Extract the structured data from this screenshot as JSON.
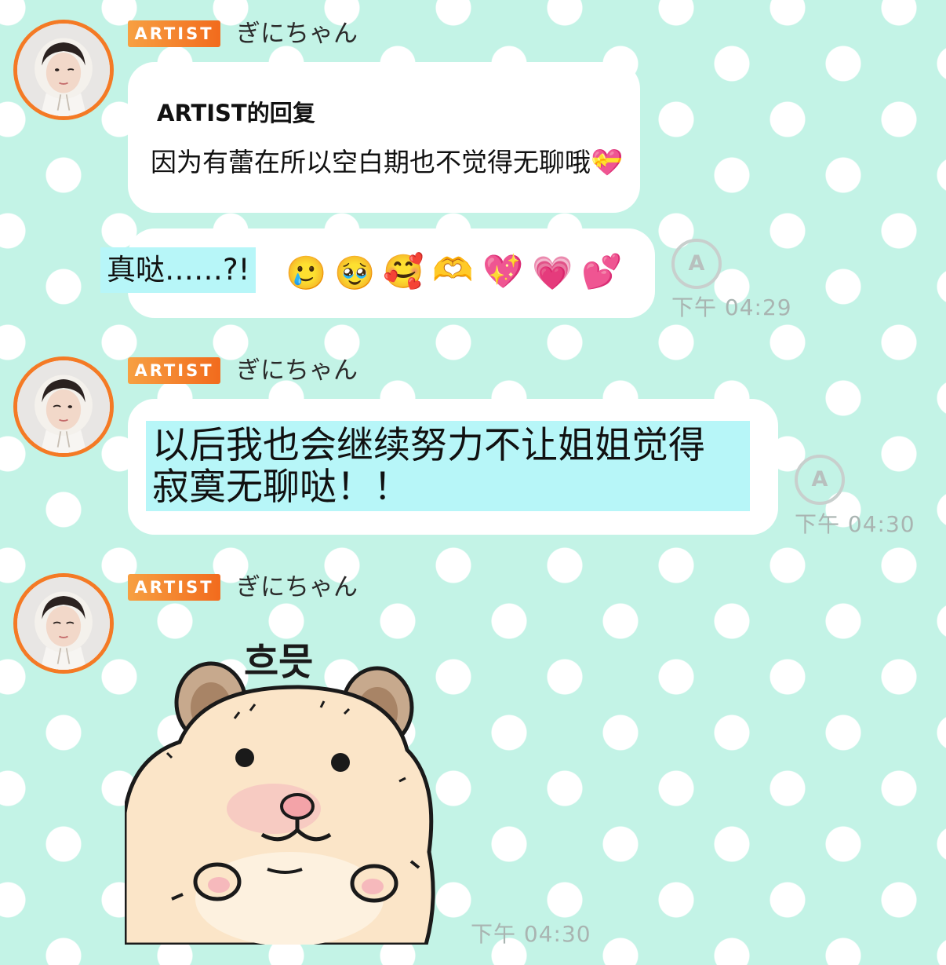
{
  "messages": [
    {
      "badge": "ARTIST",
      "sender": "ぎにちゃん",
      "reply_label": "ARTIST的回复",
      "reply_text": "因为有蕾在所以空白期也不觉得无聊哦💝"
    },
    {
      "text": "真哒……?!",
      "emojis": [
        "🥲",
        "🥹",
        "🥰",
        "🫶",
        "💖",
        "💗",
        "💕"
      ],
      "time": "下午 04:29"
    },
    {
      "badge": "ARTIST",
      "sender": "ぎにちゃん",
      "line1": "以后我也会继续努力不让姐姐觉得",
      "line2": "寂寞无聊哒！！",
      "time": "下午 04:30"
    },
    {
      "badge": "ARTIST",
      "sender": "ぎにちゃん",
      "sticker_text": "흐믓",
      "time": "下午 04:30"
    }
  ],
  "icons": {
    "translate_letter": "A"
  },
  "colors": {
    "background": "#c3f3e6",
    "badge": "#f47a25",
    "highlight": "#b7f6f8",
    "time": "#a9b4b1"
  }
}
